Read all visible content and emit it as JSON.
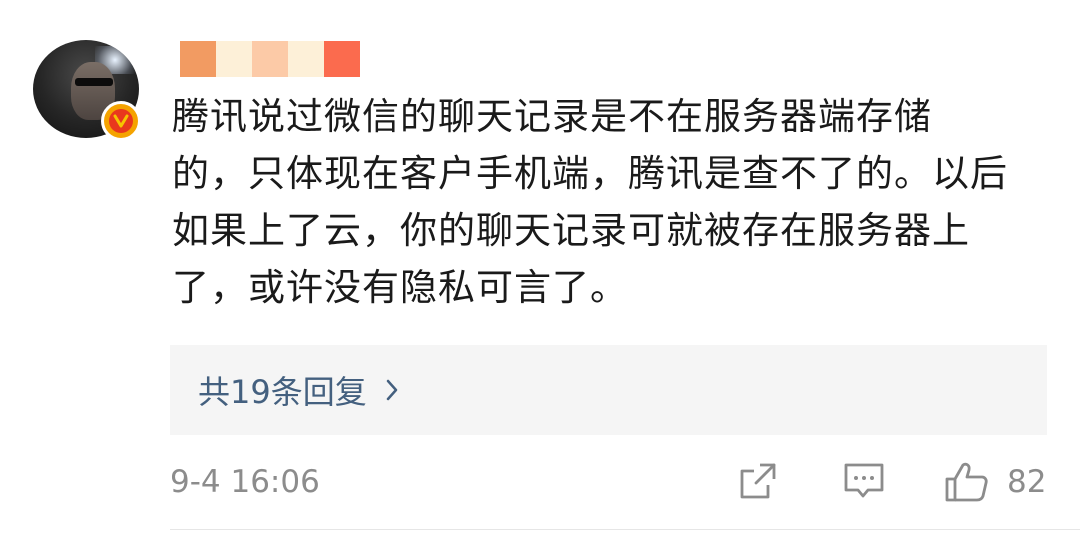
{
  "comment": {
    "username_masked": true,
    "badge": "V",
    "text": "腾讯说过微信的聊天记录是不在服务器端存储的，只体现在客户手机端，腾讯是查不了的。以后如果上了云，你的聊天记录可就被存在服务器上了，或许没有隐私可言了。",
    "text_lines": [
      "腾讯说过微信的聊天记录是不在服务器端存储",
      "的，只体现在客户手机端，腾讯是查不了的。以后",
      "如果上了云，你的聊天记录可就被存在服务器上",
      "了，或许没有隐私可言了。"
    ],
    "replies_label": "共19条回复",
    "timestamp": "9-4 16:06",
    "like_count": "82"
  },
  "colors": {
    "mask": [
      "#f29b62",
      "#fdf0d8",
      "#fccaa7",
      "#fdf0d8",
      "#fb6b4e"
    ],
    "reply_link": "#44607f",
    "meta_text": "#8c8c8c",
    "badge_outer": "#f5a300",
    "badge_inner": "#e9381d"
  },
  "icons": {
    "share": "share-icon",
    "comment": "comment-icon",
    "like": "thumbs-up-icon",
    "chevron": "chevron-right-icon"
  }
}
